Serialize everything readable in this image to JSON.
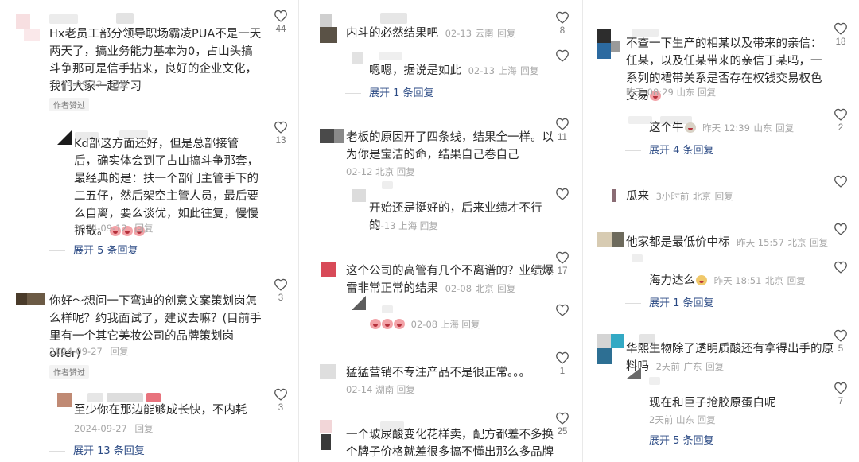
{
  "col1": {
    "c1": {
      "text": "Hx老员工部分领导职场霸凌PUA不是一天两天了，搞业务能力基本为0，占山头搞斗争那可是信手拈来，良好的企业文化，我们大家一起学习",
      "date": "2024-09-12",
      "reply": "回复",
      "tag": "作者赞过",
      "likes": "44"
    },
    "r1": {
      "text": "Kd部这方面还好，但是总部接管后，确实体会到了占山搞斗争那套，最经典的是：扶一个部门主管手下的二五仔，然后架空主管人员，最后要么自离，要么谈优，如此往复，慢慢拆散。",
      "date": "2024-09-12",
      "reply": "回复",
      "likes": "13",
      "expand": "展开 5 条回复"
    },
    "c2": {
      "text": "你好～想问一下弯迪的创意文案策划岗怎么样呢？约我面试了，建议去嘛？(目前手里有一个其它美妆公司的品牌策划岗offer)",
      "date": "2024-09-27",
      "reply": "回复",
      "tag": "作者赞过",
      "likes": "3"
    },
    "r2": {
      "text": "至少你在那边能够成长快，不内耗",
      "date": "2024-09-27",
      "reply": "回复",
      "likes": "3",
      "expand": "展开 13 条回复"
    }
  },
  "col2": {
    "c1": {
      "text": "内斗的必然结果吧",
      "date": "02-13",
      "loc": "云南",
      "reply": "回复",
      "likes": "8"
    },
    "r1": {
      "text": "嗯嗯，据说是如此",
      "date": "02-13",
      "loc": "上海",
      "reply": "回复",
      "expand": "展开 1 条回复"
    },
    "c2": {
      "text": "老板的原因开了四条线，结果全一样。以为你是宝洁的命，结果自己卷自己",
      "date": "02-12",
      "loc": "北京",
      "reply": "回复",
      "likes": "11"
    },
    "r2": {
      "text": "开始还是挺好的，后来业绩才不行的",
      "date": "02-13",
      "loc": "上海",
      "reply": "回复"
    },
    "c3": {
      "text": "这个公司的高管有几个不离谱的？业绩爆雷非常正常的结果",
      "date": "02-08",
      "loc": "北京",
      "reply": "回复",
      "likes": "17"
    },
    "r3": {
      "date": "02-08",
      "loc": "上海",
      "reply": "回复"
    },
    "c4": {
      "text": "猛猛营销不专注产品不是很正常。。。",
      "date": "02-14",
      "loc": "湖南",
      "reply": "回复",
      "likes": "1"
    },
    "c5": {
      "text": "一个玻尿酸变化花样卖，配方都差不多换个牌子价格就差很多搞不懂出那么多品牌干嘛",
      "likes": "25"
    }
  },
  "col3": {
    "c1": {
      "text": "不查一下生产的相某以及带来的亲信：任某，以及任某带来的亲信丁某吗，一系列的裙带关系是否存在权钱交易权色交易",
      "date": "昨天 08:29",
      "loc": "山东",
      "reply": "回复",
      "likes": "18"
    },
    "r1": {
      "text": "这个牛",
      "date": "昨天 12:39",
      "loc": "山东",
      "reply": "回复",
      "likes": "2",
      "expand": "展开 4 条回复"
    },
    "c2": {
      "text": "瓜来",
      "date": "3小时前",
      "loc": "北京",
      "reply": "回复"
    },
    "c3": {
      "text": "他家都是最低价中标",
      "date": "昨天 15:57",
      "loc": "北京",
      "reply": "回复"
    },
    "r3": {
      "text": "海力达么",
      "date": "昨天 18:51",
      "loc": "北京",
      "reply": "回复",
      "expand": "展开 1 条回复"
    },
    "c4": {
      "text": "华熙生物除了透明质酸还有拿得出手的原料吗",
      "date": "2天前",
      "loc": "广东",
      "reply": "回复",
      "likes": "5"
    },
    "r4": {
      "text": "现在和巨子抢胶原蛋白呢",
      "date": "2天前",
      "loc": "山东",
      "reply": "回复",
      "likes": "7",
      "expand": "展开 5 条回复"
    }
  },
  "colors": {
    "link": "#2b4a84",
    "meta": "#a6a6a6",
    "text": "#2a2a2a"
  }
}
